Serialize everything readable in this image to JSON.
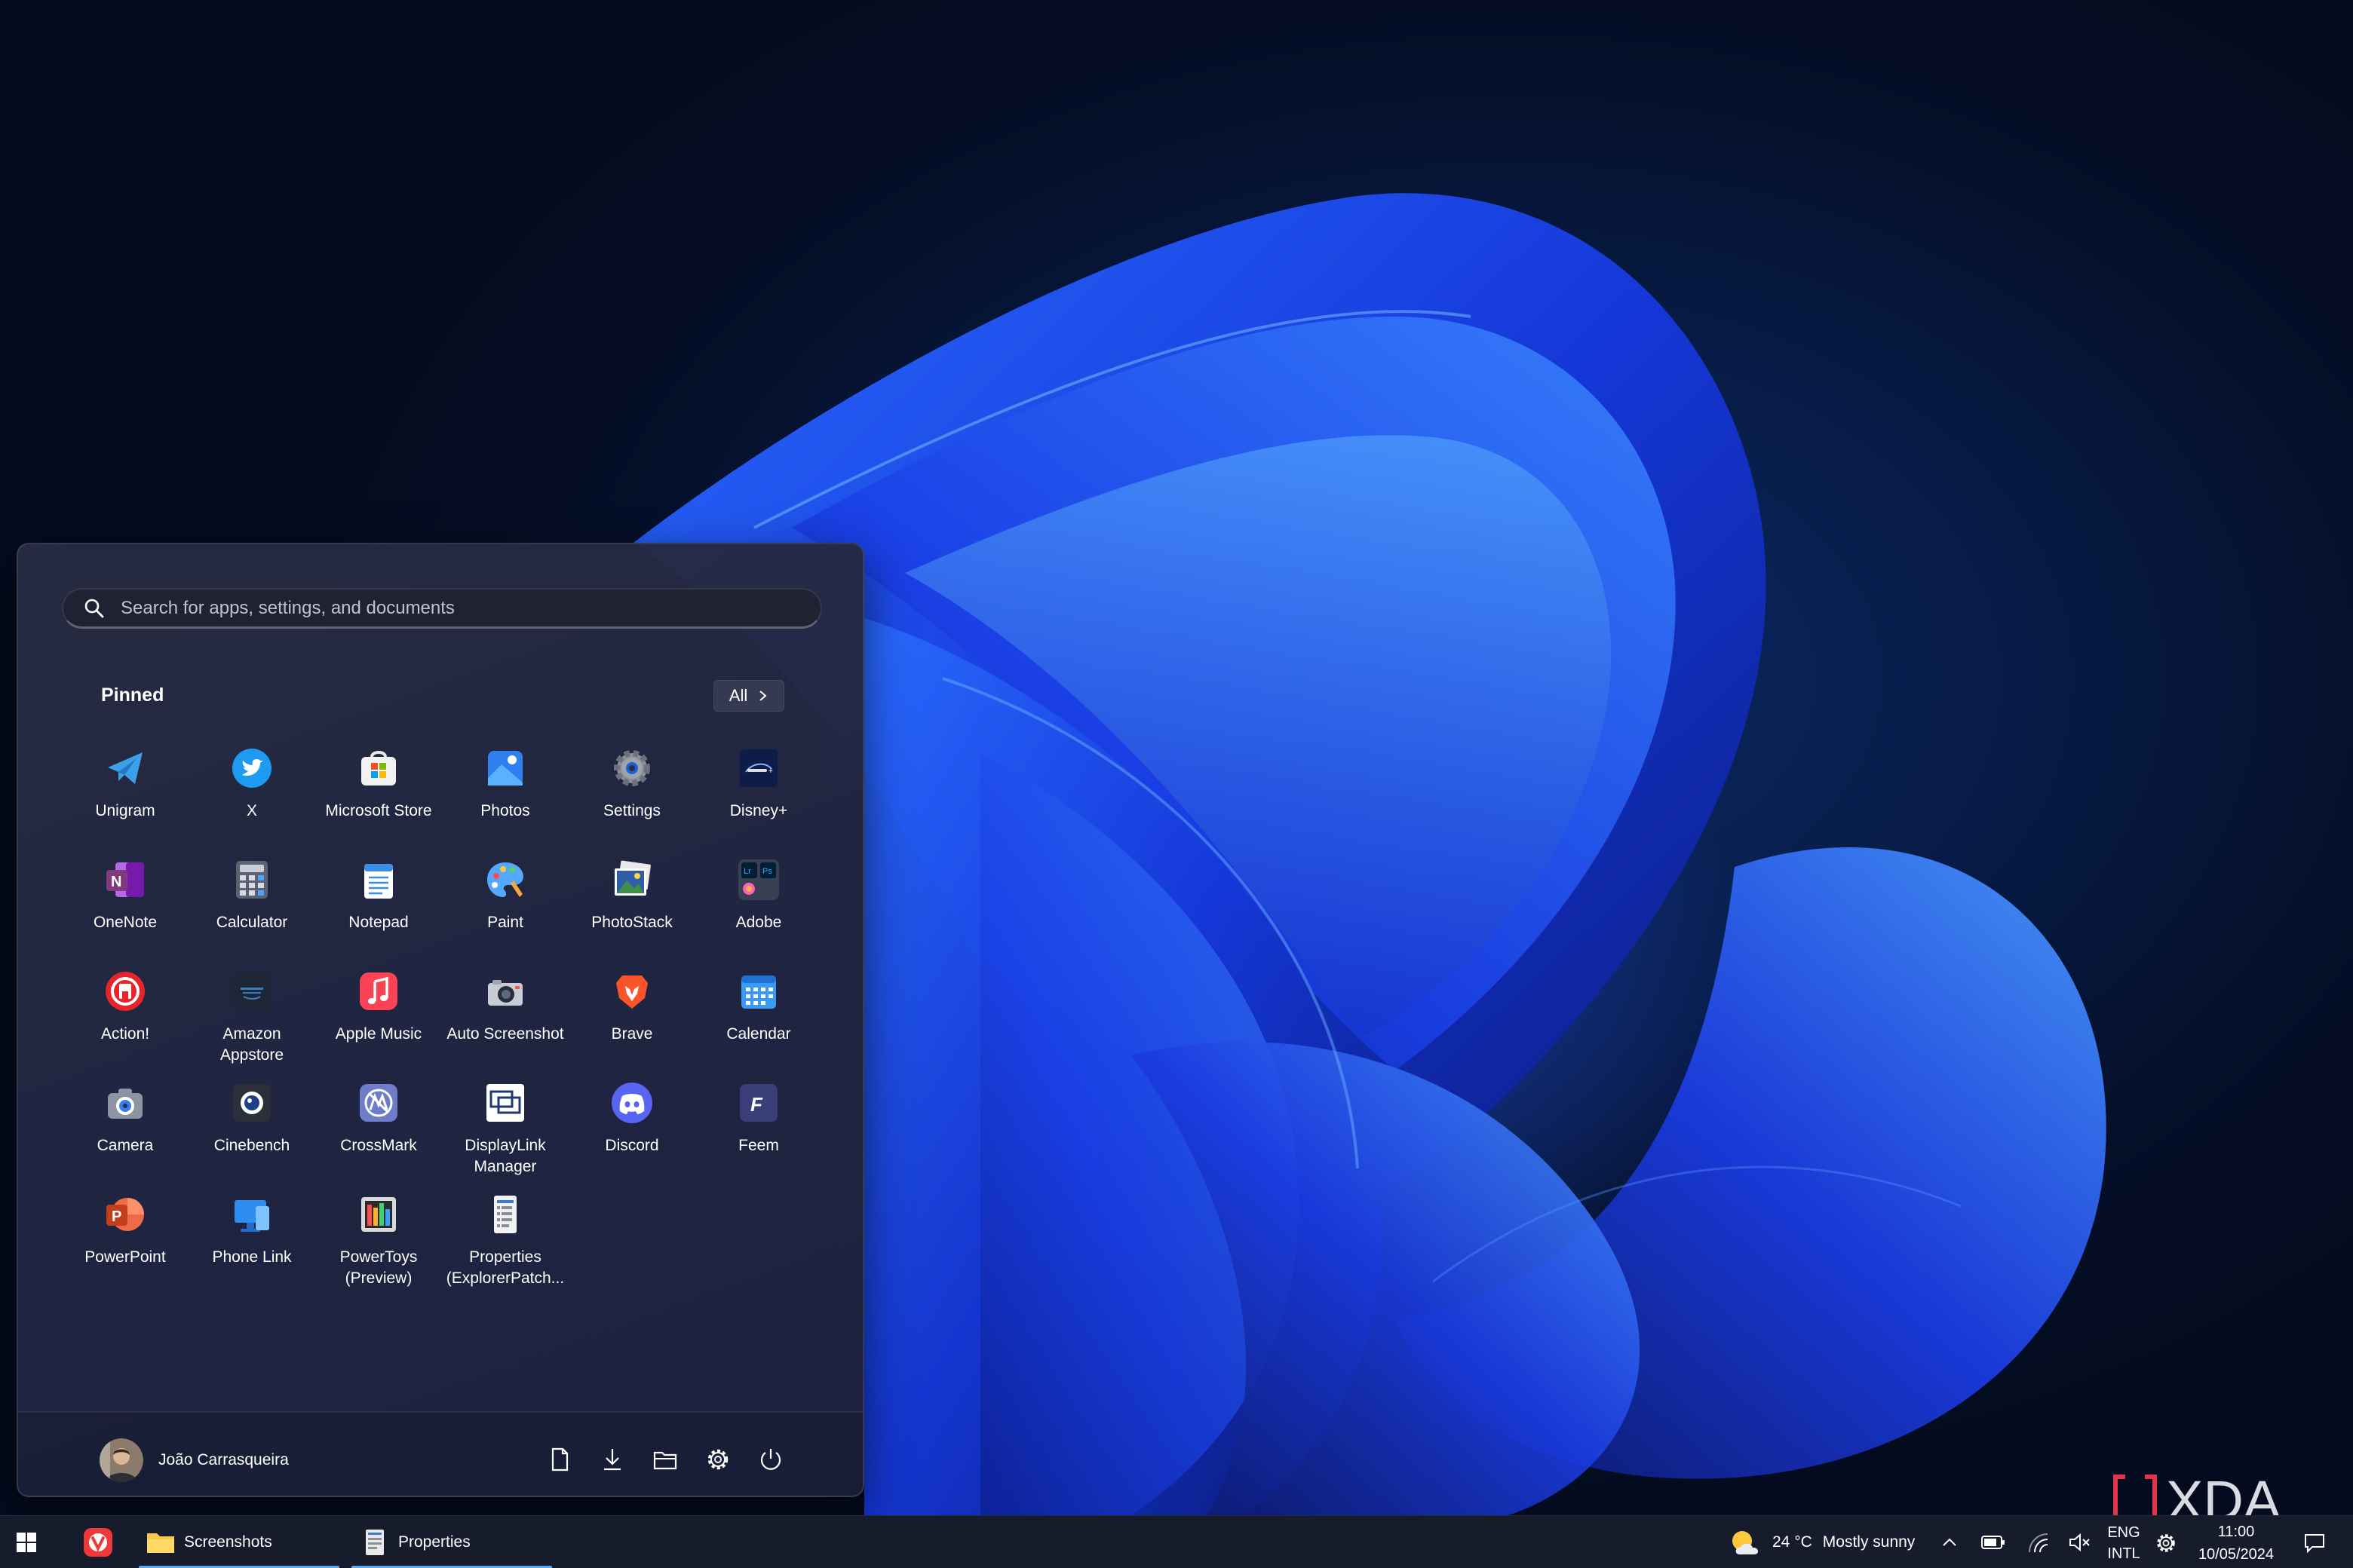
{
  "search": {
    "placeholder": "Search for apps, settings, and documents"
  },
  "pinned": {
    "title": "Pinned",
    "all_label": "All",
    "apps": [
      {
        "label": "Unigram",
        "icon": "unigram-icon"
      },
      {
        "label": "X",
        "icon": "x-twitter-icon"
      },
      {
        "label": "Microsoft Store",
        "icon": "microsoft-store-icon"
      },
      {
        "label": "Photos",
        "icon": "photos-icon"
      },
      {
        "label": "Settings",
        "icon": "settings-gear-icon"
      },
      {
        "label": "Disney+",
        "icon": "disney-plus-icon"
      },
      {
        "label": "OneNote",
        "icon": "onenote-icon"
      },
      {
        "label": "Calculator",
        "icon": "calculator-icon"
      },
      {
        "label": "Notepad",
        "icon": "notepad-icon"
      },
      {
        "label": "Paint",
        "icon": "paint-palette-icon"
      },
      {
        "label": "PhotoStack",
        "icon": "photostack-icon"
      },
      {
        "label": "Adobe",
        "icon": "adobe-folder-icon"
      },
      {
        "label": "Action!",
        "icon": "action-icon"
      },
      {
        "label": "Amazon\nAppstore",
        "icon": "amazon-appstore-icon"
      },
      {
        "label": "Apple Music",
        "icon": "apple-music-icon"
      },
      {
        "label": "Auto Screenshot",
        "icon": "auto-screenshot-camera-icon"
      },
      {
        "label": "Brave",
        "icon": "brave-lion-icon"
      },
      {
        "label": "Calendar",
        "icon": "calendar-icon"
      },
      {
        "label": "Camera",
        "icon": "camera-icon"
      },
      {
        "label": "Cinebench",
        "icon": "cinebench-icon"
      },
      {
        "label": "CrossMark",
        "icon": "crossmark-icon"
      },
      {
        "label": "DisplayLink\nManager",
        "icon": "displaylink-icon"
      },
      {
        "label": "Discord",
        "icon": "discord-icon"
      },
      {
        "label": "Feem",
        "icon": "feem-icon"
      },
      {
        "label": "PowerPoint",
        "icon": "powerpoint-icon"
      },
      {
        "label": "Phone Link",
        "icon": "phone-link-icon"
      },
      {
        "label": "PowerToys\n(Preview)",
        "icon": "powertoys-icon"
      },
      {
        "label": "Properties\n(ExplorerPatch...",
        "icon": "properties-icon"
      }
    ]
  },
  "user": {
    "name": "João Carrasqueira",
    "avatar_icon": "avatar-icon"
  },
  "footer_icons": [
    "documents-icon",
    "downloads-icon",
    "file-explorer-icon",
    "settings-icon",
    "power-icon"
  ],
  "taskbar": {
    "start_icon": "windows-start-icon",
    "items": [
      {
        "label": "",
        "icon": "vivaldi-icon"
      },
      {
        "label": "Screenshots",
        "icon": "folder-icon"
      },
      {
        "label": "Properties",
        "icon": "properties-icon"
      }
    ],
    "weather": {
      "temp": "24 °C",
      "condition": "Mostly sunny",
      "icon": "partly-sunny-icon"
    },
    "tray_icons": [
      "chevron-up-icon",
      "battery-icon",
      "wifi-icon",
      "volume-muted-icon"
    ],
    "language": {
      "line1": "ENG",
      "line2": "INTL"
    },
    "settings_icon": "settings-gear-icon",
    "clock": {
      "time": "11:00",
      "date": "10/05/2024"
    },
    "notification_icon": "notification-icon"
  },
  "watermark": {
    "text": "XDA"
  },
  "colors": {
    "accent": "#5ba8f5",
    "start_bg": "#262b44",
    "taskbar_bg": "#161c2c",
    "wallpaper_blue": "#1d3fe0"
  }
}
